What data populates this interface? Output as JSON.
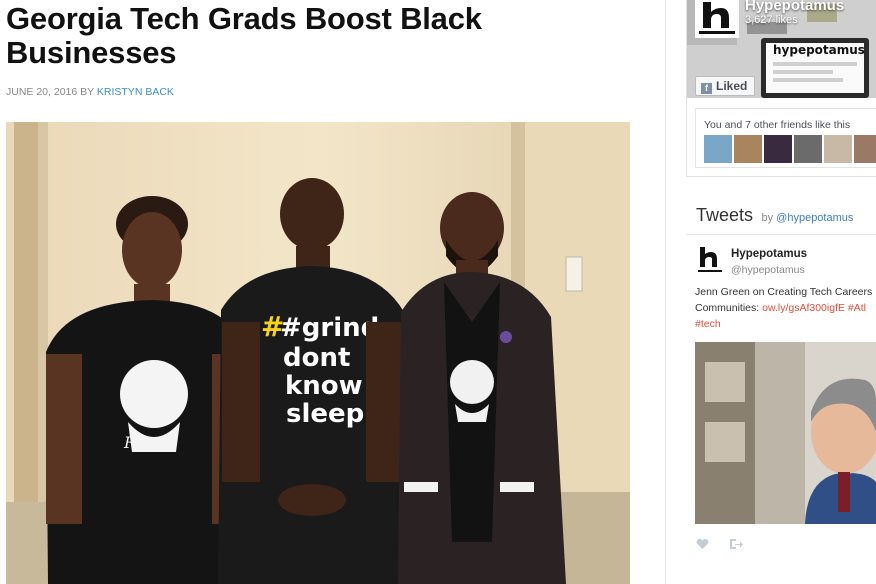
{
  "article": {
    "title": "Georgia Tech Grads Boost Black Businesses",
    "date": "JUNE 20, 2016",
    "by": "BY",
    "author": "KRISTYN BACK",
    "shirt_text": [
      "#grind",
      "dont",
      "know",
      "sleep"
    ],
    "signature": "RooA"
  },
  "facebook": {
    "page_name": "Hypepotamus",
    "likes": "3,627 likes",
    "logo_text": "hypepotamus",
    "liked_label": "Liked",
    "friends_text": "You and 7 other friends like this",
    "friend_count_shown": 6
  },
  "twitter": {
    "title": "Tweets",
    "by": "by",
    "handle_link": "@hypepotamus",
    "tweet": {
      "name": "Hypepotamus",
      "handle": "@hypepotamus",
      "line1": "Jenn Green on Creating Tech Careers",
      "line2_prefix": "Communities:",
      "link": "ow.ly/gsAf300igfE",
      "hashtag1": "#Atl",
      "hashtag2": "#tech"
    },
    "actions": [
      "heart-icon",
      "share-icon"
    ]
  },
  "colors": {
    "author_link": "#3a8fc8",
    "tweet_link": "#e24b3a",
    "tw_handle": "#3a7fc0"
  }
}
